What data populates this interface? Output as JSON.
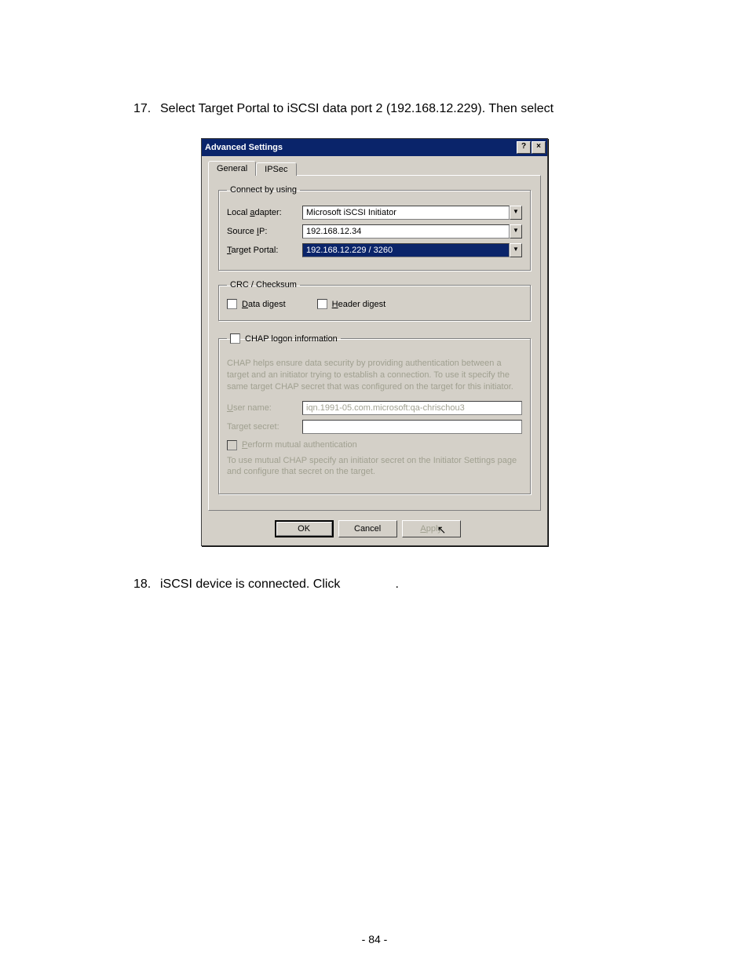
{
  "step17": {
    "num": "17.",
    "text": "Select Target Portal to iSCSI data port 2 (192.168.12.229). Then select"
  },
  "step18": {
    "num": "18.",
    "text": "iSCSI device is connected. Click",
    "trail": "."
  },
  "dialog": {
    "title": "Advanced Settings",
    "help": "?",
    "close": "×",
    "tabs": {
      "general": "General",
      "ipsec": "IPSec"
    },
    "connect_legend": "Connect by using",
    "local_adapter_pre": "Local ",
    "local_adapter_u": "a",
    "local_adapter_post": "dapter:",
    "local_adapter_value": "Microsoft iSCSI Initiator",
    "source_pre": "Source ",
    "source_u": "I",
    "source_post": "P:",
    "source_value": "192.168.12.34",
    "target_u": "T",
    "target_post": "arget Portal:",
    "target_value": "192.168.12.229 / 3260",
    "crc_legend": "CRC / Checksum",
    "data_u": "D",
    "data_post": "ata digest",
    "header_u": "H",
    "header_post": "eader digest",
    "chap_legend": "CHAP logon information",
    "chap_desc": "CHAP helps ensure data security by providing authentication between a target and an initiator trying to establish a connection. To use it specify the same target CHAP secret that was configured on the target for this initiator.",
    "user_u": "U",
    "user_post": "ser name:",
    "user_value": "iqn.1991-05.com.microsoft:qa-chrischou3",
    "secret_label": "Target secret:",
    "secret_value": "",
    "mutual_u": "P",
    "mutual_post": "erform mutual authentication",
    "mutual_desc": "To use mutual CHAP specify an initiator secret on the Initiator Settings page and configure that secret on the target.",
    "ok": "OK",
    "cancel": "Cancel",
    "apply_u": "A",
    "apply_post": "pply"
  },
  "footer": "- 84 -"
}
